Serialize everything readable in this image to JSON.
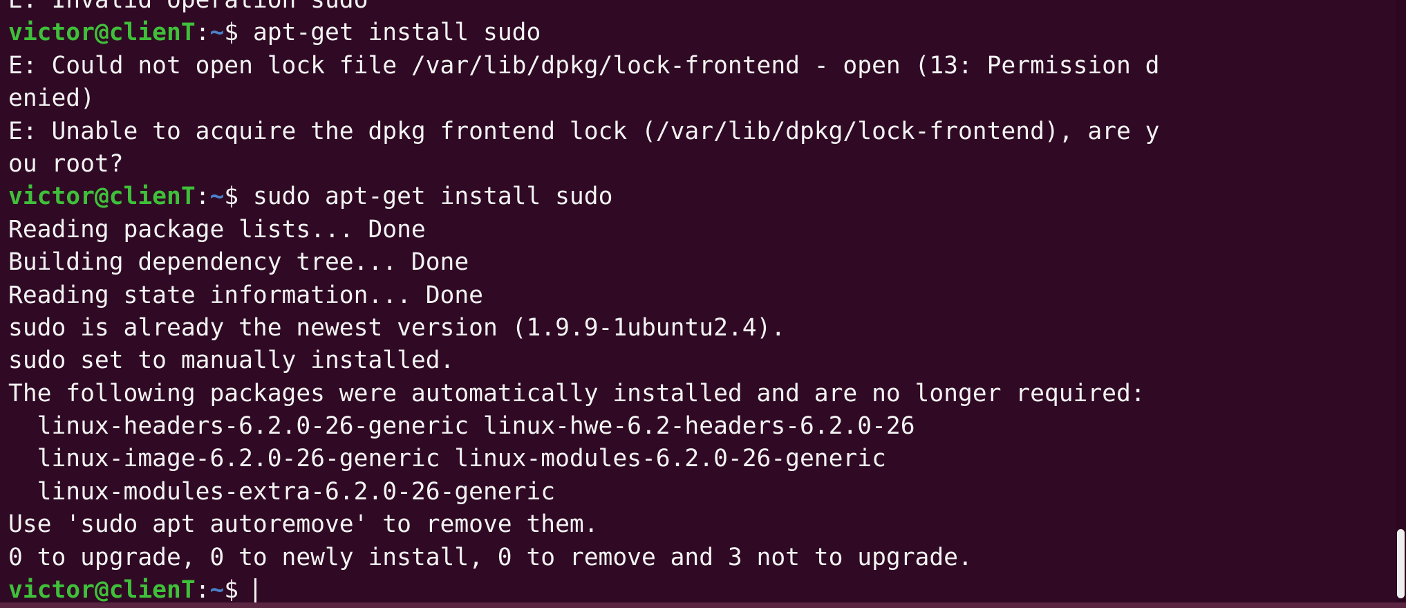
{
  "colors": {
    "background": "#300a24",
    "text": "#f2f2f2",
    "prompt_user": "#3fc03a",
    "prompt_path": "#4a80c8"
  },
  "prompt": {
    "user_host": "victor@clienT",
    "separator": ":",
    "path": "~",
    "symbol": "$ "
  },
  "terminal": {
    "lines": [
      {
        "text": "E: Invalid operation sudo"
      },
      {
        "command": "apt-get install sudo"
      },
      {
        "text": "E: Could not open lock file /var/lib/dpkg/lock-frontend - open (13: Permission d"
      },
      {
        "text": "enied)"
      },
      {
        "text": "E: Unable to acquire the dpkg frontend lock (/var/lib/dpkg/lock-frontend), are y"
      },
      {
        "text": "ou root?"
      },
      {
        "command": "sudo apt-get install sudo"
      },
      {
        "text": "Reading package lists... Done"
      },
      {
        "text": "Building dependency tree... Done"
      },
      {
        "text": "Reading state information... Done"
      },
      {
        "text": "sudo is already the newest version (1.9.9-1ubuntu2.4)."
      },
      {
        "text": "sudo set to manually installed."
      },
      {
        "text": "The following packages were automatically installed and are no longer required:"
      },
      {
        "text": "  linux-headers-6.2.0-26-generic linux-hwe-6.2-headers-6.2.0-26"
      },
      {
        "text": "  linux-image-6.2.0-26-generic linux-modules-6.2.0-26-generic"
      },
      {
        "text": "  linux-modules-extra-6.2.0-26-generic"
      },
      {
        "text": "Use 'sudo apt autoremove' to remove them."
      },
      {
        "text": "0 to upgrade, 0 to newly install, 0 to remove and 3 not to upgrade."
      },
      {
        "command": ""
      }
    ]
  }
}
